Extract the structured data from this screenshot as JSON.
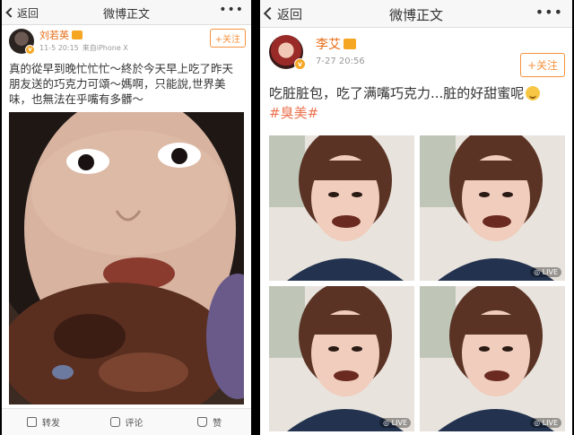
{
  "left_panel": {
    "nav": {
      "back_label": "返回",
      "title": "微博正文",
      "more": "•••"
    },
    "author": {
      "name": "刘若英",
      "time": "11-5 20:15",
      "source": "来自iPhone X"
    },
    "follow_label": "+关注",
    "post_text": "真的從早到晚忙忙忙～終於今天早上吃了昨天朋友送的巧克力可頌～媽啊，只能說,世界美味，也無法在乎嘴有多髒～",
    "actions": {
      "repost": "转发",
      "comment": "评论",
      "like": "赞"
    }
  },
  "right_panel": {
    "nav": {
      "back_label": "返回",
      "title": "微博正文",
      "more": "•••"
    },
    "author": {
      "name": "李艾",
      "time": "7-27 20:56"
    },
    "follow_label": "+关注",
    "post_text": "吃脏脏包，吃了满嘴巧克力...脏的好甜蜜呢",
    "hashtag": "#臭美#",
    "live_badge": "LIVE"
  },
  "colors": {
    "accent_orange": "#f5923e",
    "name_orange": "#e86a12",
    "hashtag": "#eb7350",
    "chocolate": "#5a2f20"
  }
}
